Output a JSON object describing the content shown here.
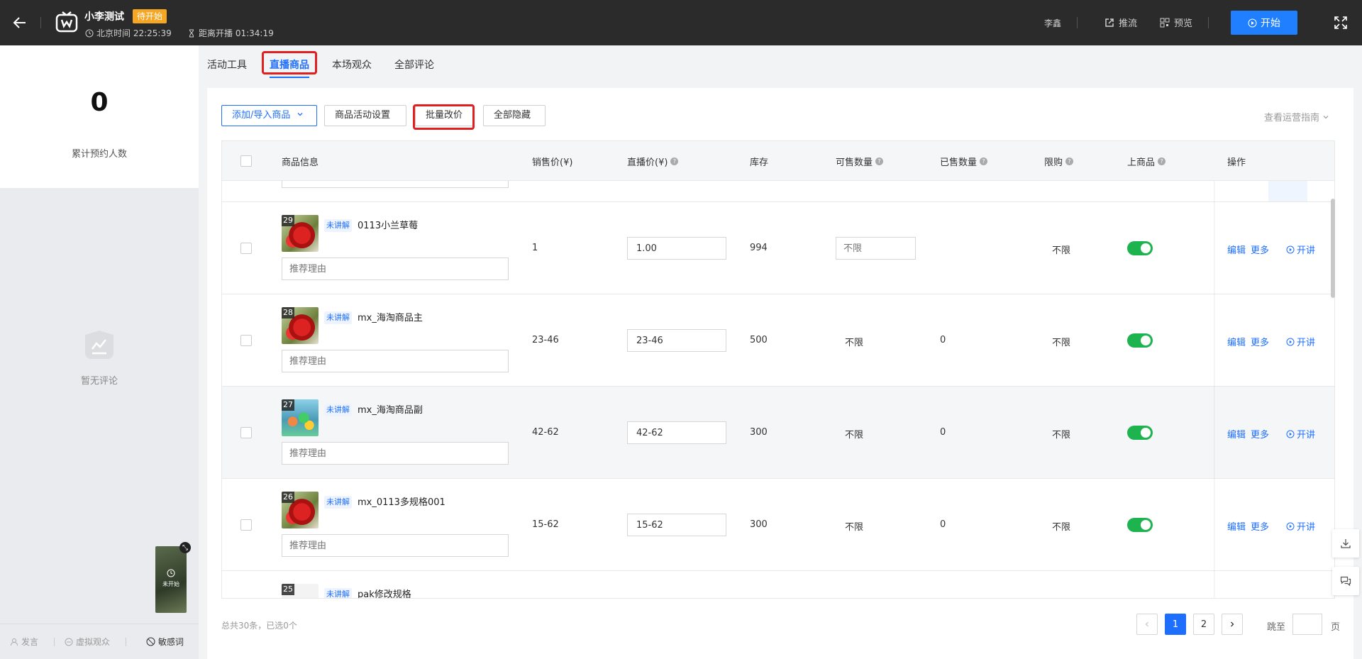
{
  "header": {
    "room_title": "小李测试",
    "status_badge": "待开始",
    "beijing_time": "北京时间 22:25:39",
    "countdown": "距离开播 01:34:19",
    "user_name": "李鑫",
    "push_stream": "推流",
    "preview": "预览",
    "start_button": "开始"
  },
  "left": {
    "stat_value": "0",
    "stat_label": "累计预约人数",
    "no_comment": "暂无评论",
    "thumb_label": "未开始",
    "footer": {
      "speak": "发言",
      "virtual_audience": "虚拟观众",
      "sensitive_words": "敏感词"
    }
  },
  "tabs": [
    "活动工具",
    "直播商品",
    "本场观众",
    "全部评论"
  ],
  "toolbar": {
    "add_import": "添加/导入商品",
    "activity_settings": "商品活动设置",
    "batch_price": "批量改价",
    "hide_all": "全部隐藏",
    "guide": "查看运营指南"
  },
  "table": {
    "headers": {
      "info": "商品信息",
      "sale_price": "销售价(¥)",
      "live_price": "直播价(¥)",
      "stock": "库存",
      "available": "可售数量",
      "sold": "已售数量",
      "limit": "限购",
      "on_shelf": "上商品",
      "actions": "操作"
    },
    "rows": [
      {
        "num": "29",
        "tag": "未讲解",
        "name": "0113小兰草莓",
        "reason_placeholder": "推荐理由",
        "sale_price": "1",
        "live_price": "1.00",
        "stock": "994",
        "available_placeholder": "不限",
        "sold": "",
        "limit": "不限",
        "edit": "编辑",
        "more": "更多",
        "explain": "开讲"
      },
      {
        "num": "28",
        "tag": "未讲解",
        "name": "mx_海淘商品主",
        "reason_placeholder": "推荐理由",
        "sale_price": "23-46",
        "live_price": "23-46",
        "stock": "500",
        "available": "不限",
        "sold": "0",
        "limit": "不限",
        "edit": "编辑",
        "more": "更多",
        "explain": "开讲"
      },
      {
        "num": "27",
        "tag": "未讲解",
        "name": "mx_海淘商品副",
        "reason_placeholder": "推荐理由",
        "sale_price": "42-62",
        "live_price": "42-62",
        "stock": "300",
        "available": "不限",
        "sold": "0",
        "limit": "不限",
        "edit": "编辑",
        "more": "更多",
        "explain": "开讲"
      },
      {
        "num": "26",
        "tag": "未讲解",
        "name": "mx_0113多规格001",
        "reason_placeholder": "推荐理由",
        "sale_price": "15-62",
        "live_price": "15-62",
        "stock": "300",
        "available": "不限",
        "sold": "0",
        "limit": "不限",
        "edit": "编辑",
        "more": "更多",
        "explain": "开讲"
      },
      {
        "num": "25",
        "tag": "未讲解",
        "name": "pak修改规格"
      }
    ]
  },
  "footer": {
    "total": "总共30条，已选0个",
    "pages": [
      "1",
      "2"
    ],
    "jump_to": "跳至",
    "page_unit": "页"
  },
  "colors": {
    "accent": "#1f6fff",
    "toggle_on": "#1db34f",
    "badge": "#f5a623",
    "highlight": "#e02020"
  }
}
